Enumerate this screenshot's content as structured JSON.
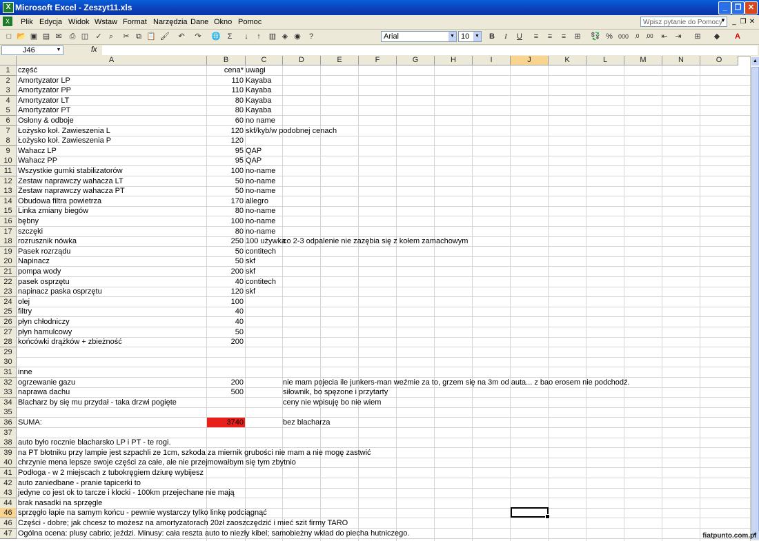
{
  "window": {
    "title": "Microsoft Excel - Zeszyt11.xls",
    "minimize": "_",
    "restore": "❐",
    "close": "✕"
  },
  "menu": {
    "items": [
      "Plik",
      "Edycja",
      "Widok",
      "Wstaw",
      "Format",
      "Narzędzia",
      "Dane",
      "Okno",
      "Pomoc"
    ],
    "help_placeholder": "Wpisz pytanie do Pomocy"
  },
  "toolbar": {
    "font": "Arial",
    "size": "10",
    "bold": "B",
    "italic": "I",
    "underline": "U"
  },
  "formula_bar": {
    "name_box": "J46",
    "fx": "fx",
    "content": ""
  },
  "columns": [
    "A",
    "B",
    "C",
    "D",
    "E",
    "F",
    "G",
    "H",
    "I",
    "J",
    "K",
    "L",
    "M",
    "N",
    "O"
  ],
  "active_column": "J",
  "active_row": "46",
  "rows": [
    {
      "n": "1",
      "a": "część",
      "b": "cena*",
      "c": "uwagi",
      "d": ""
    },
    {
      "n": "2",
      "a": "Amortyzator LP",
      "b": "110",
      "c": "Kayaba",
      "d": ""
    },
    {
      "n": "3",
      "a": "Amortyzator PP",
      "b": "110",
      "c": "Kayaba",
      "d": ""
    },
    {
      "n": "4",
      "a": "Amortyzator LT",
      "b": "80",
      "c": "Kayaba",
      "d": ""
    },
    {
      "n": "5",
      "a": "Amortyzator PT",
      "b": "80",
      "c": "Kayaba",
      "d": ""
    },
    {
      "n": "6",
      "a": "Osłony & odboje",
      "b": "60",
      "c": "no name",
      "d": ""
    },
    {
      "n": "7",
      "a": "Łożysko koł. Zawieszenia L",
      "b": "120",
      "c": "skf/kyb/w podobnej cenach",
      "d": ""
    },
    {
      "n": "8",
      "a": "Łożysko koł. Zawieszenia P",
      "b": "120",
      "c": "",
      "d": ""
    },
    {
      "n": "9",
      "a": "Wahacz LP",
      "b": "95",
      "c": "QAP",
      "d": ""
    },
    {
      "n": "10",
      "a": "Wahacz PP",
      "b": "95",
      "c": "QAP",
      "d": ""
    },
    {
      "n": "11",
      "a": "Wszystkie gumki stabilizatorów",
      "b": "100",
      "c": "no-name",
      "d": ""
    },
    {
      "n": "12",
      "a": "Zestaw naprawczy wahacza LT",
      "b": "50",
      "c": "no-name",
      "d": ""
    },
    {
      "n": "13",
      "a": "Zestaw naprawczy wahacza PT",
      "b": "50",
      "c": "no-name",
      "d": ""
    },
    {
      "n": "14",
      "a": "Obudowa filtra powietrza",
      "b": "170",
      "c": "allegro",
      "d": ""
    },
    {
      "n": "15",
      "a": "Linka zmiany biegów",
      "b": "80",
      "c": "no-name",
      "d": ""
    },
    {
      "n": "16",
      "a": "bębny",
      "b": "100",
      "c": "no-name",
      "d": ""
    },
    {
      "n": "17",
      "a": "szczęki",
      "b": "80",
      "c": "no-name",
      "d": ""
    },
    {
      "n": "18",
      "a": "rozrusznik nówka",
      "b": "250",
      "c": "100 używka",
      "d": "           co 2-3 odpalenie nie zazębia się z kołem zamachowym"
    },
    {
      "n": "19",
      "a": "Pasek rozrządu",
      "b": "50",
      "c": "contitech",
      "d": ""
    },
    {
      "n": "20",
      "a": "Napinacz",
      "b": "50",
      "c": "skf",
      "d": ""
    },
    {
      "n": "21",
      "a": "pompa wody",
      "b": "200",
      "c": "skf",
      "d": ""
    },
    {
      "n": "22",
      "a": "pasek osprzętu",
      "b": "40",
      "c": "contitech",
      "d": ""
    },
    {
      "n": "23",
      "a": "napinacz paska osprzętu",
      "b": "120",
      "c": "skf",
      "d": ""
    },
    {
      "n": "24",
      "a": "olej",
      "b": "100",
      "c": "",
      "d": ""
    },
    {
      "n": "25",
      "a": "filtry",
      "b": "40",
      "c": "",
      "d": ""
    },
    {
      "n": "26",
      "a": "płyn chłodniczy",
      "b": "40",
      "c": "",
      "d": ""
    },
    {
      "n": "27",
      "a": "płyn hamulcowy",
      "b": "50",
      "c": "",
      "d": ""
    },
    {
      "n": "28",
      "a": "końcówki drążków + zbieżność",
      "b": "200",
      "c": "",
      "d": ""
    },
    {
      "n": "29",
      "a": "",
      "b": "",
      "c": "",
      "d": ""
    },
    {
      "n": "30",
      "a": "",
      "b": "",
      "c": "",
      "d": ""
    },
    {
      "n": "31",
      "a": "inne",
      "b": "",
      "c": "",
      "d": ""
    },
    {
      "n": "32",
      "a": "ogrzewanie gazu",
      "b": "200",
      "c": "",
      "d": "nie mam pojecia ile junkers-man weźmie za to, grzem się na 3m od auta... z bao erosem nie podchodź."
    },
    {
      "n": "33",
      "a": "naprawa dachu",
      "b": "500",
      "c": "",
      "d": "siłownik, bo spęzone i przytarty"
    },
    {
      "n": "34",
      "a": "Blacharz by się mu przydał - taka drzwi pogięte",
      "b": "",
      "c": "",
      "d": "ceny nie wpisuję bo nie wiem"
    },
    {
      "n": "35",
      "a": "",
      "b": "",
      "c": "",
      "d": ""
    },
    {
      "n": "36",
      "a": "SUMA:",
      "b": "3740",
      "c": "",
      "d": "bez blacharza",
      "red": true
    },
    {
      "n": "37",
      "a": "",
      "b": "",
      "c": "",
      "d": ""
    },
    {
      "n": "38",
      "a": "auto było rocznie blacharsko LP i PT - te rogi.",
      "b": "",
      "c": "",
      "d": ""
    },
    {
      "n": "39",
      "a": "na PT błotniku przy lampie jest szpachli ze 1cm, szkoda za miernik grubości nie mam a nie mogę zastwić",
      "b": "",
      "c": "",
      "d": ""
    },
    {
      "n": "40",
      "a": "chrzynie mena lepsze swoje części za całe, ale nie przejmowałbym się tym zbytnio",
      "b": "",
      "c": "",
      "d": ""
    },
    {
      "n": "41",
      "a": "Podłoga - w 2 miejscach z tubokręgiem dziurę wybijesz",
      "b": "",
      "c": "",
      "d": ""
    },
    {
      "n": "42",
      "a": "auto zaniedbane - pranie tapicerki to",
      "b": "",
      "c": "",
      "d": ""
    },
    {
      "n": "43",
      "a": "jedyne co jest ok to tarcze i klocki - 100km przejechane nie mają",
      "b": "",
      "c": "",
      "d": ""
    },
    {
      "n": "44",
      "a": "brak nasadki na sprzęgle",
      "b": "",
      "c": "",
      "d": ""
    },
    {
      "n": "46",
      "a": "sprzęgło łapie na samym końcu - pewnie wystarczy tylko linkę podciągnąć",
      "b": "",
      "c": "",
      "d": ""
    },
    {
      "n": "46",
      "a": "Części - dobre; jak chcesz to możesz na amortyzatorach 20zł zaoszczędzić i mieć szit firmy TARO",
      "b": "",
      "c": "",
      "d": ""
    },
    {
      "n": "47",
      "a": "Ogólna ocena: plusy cabrio; jeździ. Minusy: cała reszta auto to niezły kibel; samobieżny wkład do piecha hutniczego.",
      "b": "",
      "c": "",
      "d": ""
    }
  ],
  "watermark": "fiatpunto.com.pl"
}
